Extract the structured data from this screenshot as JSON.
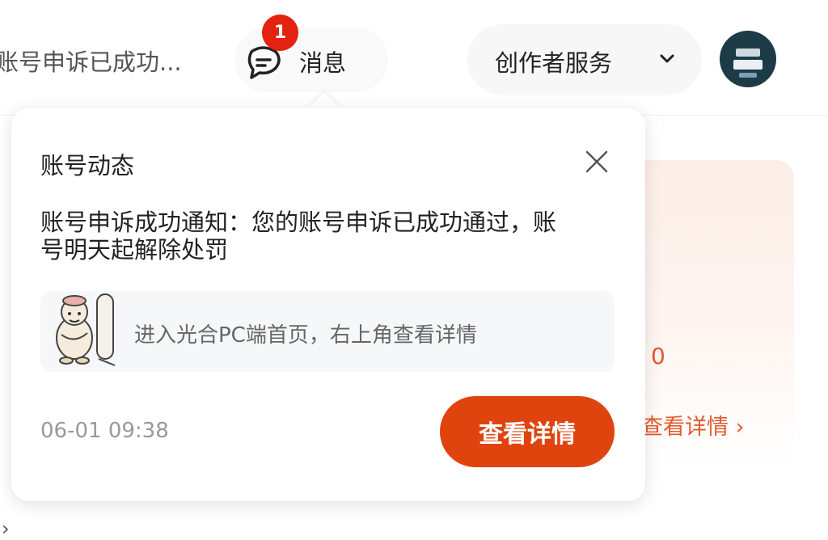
{
  "header": {
    "notice_text": "账号申诉已成功...",
    "messages": {
      "label": "消息",
      "badge": "1"
    },
    "creator_service": {
      "label": "创作者服务"
    }
  },
  "popup": {
    "title": "账号动态",
    "body": "账号申诉成功通知：您的账号申诉已成功通过，账号明天起解除处罚",
    "hint": "进入光合PC端首页，右上角查看详情",
    "time": "06-01 09:38",
    "button_label": "查看详情"
  },
  "background_card": {
    "value": "0",
    "link": "查看详情 ›"
  },
  "colors": {
    "accent": "#e0440e",
    "badge": "#e3230f",
    "avatar": "#1d3a47"
  },
  "icons": [
    "message-icon",
    "chevron-down-icon",
    "close-icon",
    "avatar"
  ]
}
